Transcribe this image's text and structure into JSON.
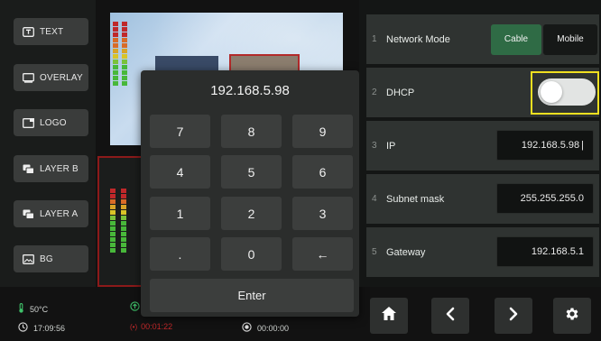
{
  "sidebar": {
    "buttons": [
      {
        "label": "TEXT",
        "icon": "text-box-icon"
      },
      {
        "label": "OVERLAY",
        "icon": "overlay-icon"
      },
      {
        "label": "LOGO",
        "icon": "logo-icon"
      },
      {
        "label": "LAYER B",
        "icon": "layer-b-icon"
      },
      {
        "label": "LAYER A",
        "icon": "layer-a-icon"
      },
      {
        "label": "BG",
        "icon": "background-image-icon"
      }
    ]
  },
  "status": {
    "temperature": "50°C",
    "clock": "17:09:56",
    "stream_time": "00:01:22",
    "record_time": "00:00:00"
  },
  "keypad": {
    "display": "192.168.5.98",
    "keys": [
      "7",
      "8",
      "9",
      "4",
      "5",
      "6",
      "1",
      "2",
      "3",
      ".",
      "0",
      "←"
    ],
    "enter": "Enter"
  },
  "network": {
    "rows": [
      {
        "num": "1",
        "label": "Network Mode"
      },
      {
        "num": "2",
        "label": "DHCP"
      },
      {
        "num": "3",
        "label": "IP",
        "value": "192.168.5.98"
      },
      {
        "num": "4",
        "label": "Subnet mask",
        "value": "255.255.255.0"
      },
      {
        "num": "5",
        "label": "Gateway",
        "value": "192.168.5.1"
      }
    ],
    "mode_cable": "Cable",
    "mode_mobile": "Mobile",
    "dhcp_enabled": false
  },
  "colors": {
    "accent_green": "#2f6b45",
    "focus_yellow": "#f0e020",
    "alert_red": "#c0282a"
  }
}
